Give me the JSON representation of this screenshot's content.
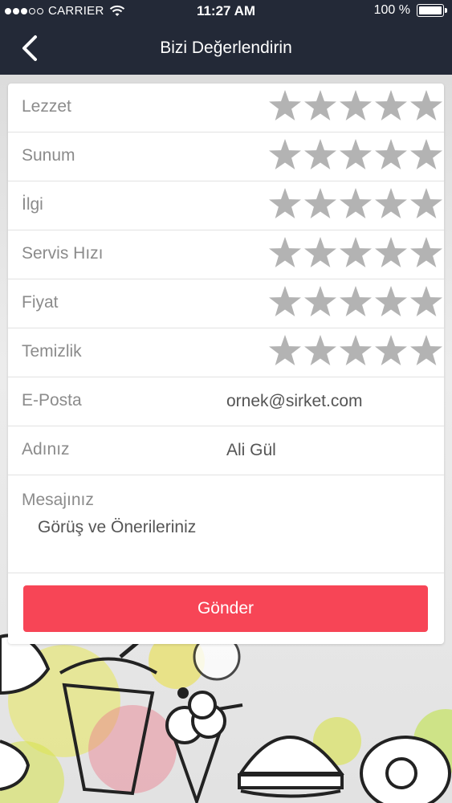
{
  "status_bar": {
    "carrier": "CARRIER",
    "time": "11:27 AM",
    "battery": "100 %",
    "battery_level": 1.0,
    "signal_bars_filled": 3,
    "signal_bars_total": 5
  },
  "header": {
    "title": "Bizi Değerlendirin",
    "back_icon": "chevron-left-icon"
  },
  "ratings": [
    {
      "label": "Lezzet",
      "stars": 0,
      "max": 5
    },
    {
      "label": "Sunum",
      "stars": 0,
      "max": 5
    },
    {
      "label": "İlgi",
      "stars": 0,
      "max": 5
    },
    {
      "label": "Servis Hızı",
      "stars": 0,
      "max": 5
    },
    {
      "label": "Fiyat",
      "stars": 0,
      "max": 5
    },
    {
      "label": "Temizlik",
      "stars": 0,
      "max": 5
    }
  ],
  "form": {
    "email_label": "E-Posta",
    "email_value": "ornek@sirket.com",
    "name_label": "Adınız",
    "name_value": "Ali Gül",
    "message_label": "Mesajınız",
    "message_placeholder": "Görüş ve Önerileriniz",
    "submit_label": "Gönder"
  },
  "colors": {
    "nav_bg": "#232937",
    "submit_bg": "#f74556",
    "star_empty": "#b3b3b3",
    "label_text": "#8b8b8b"
  }
}
